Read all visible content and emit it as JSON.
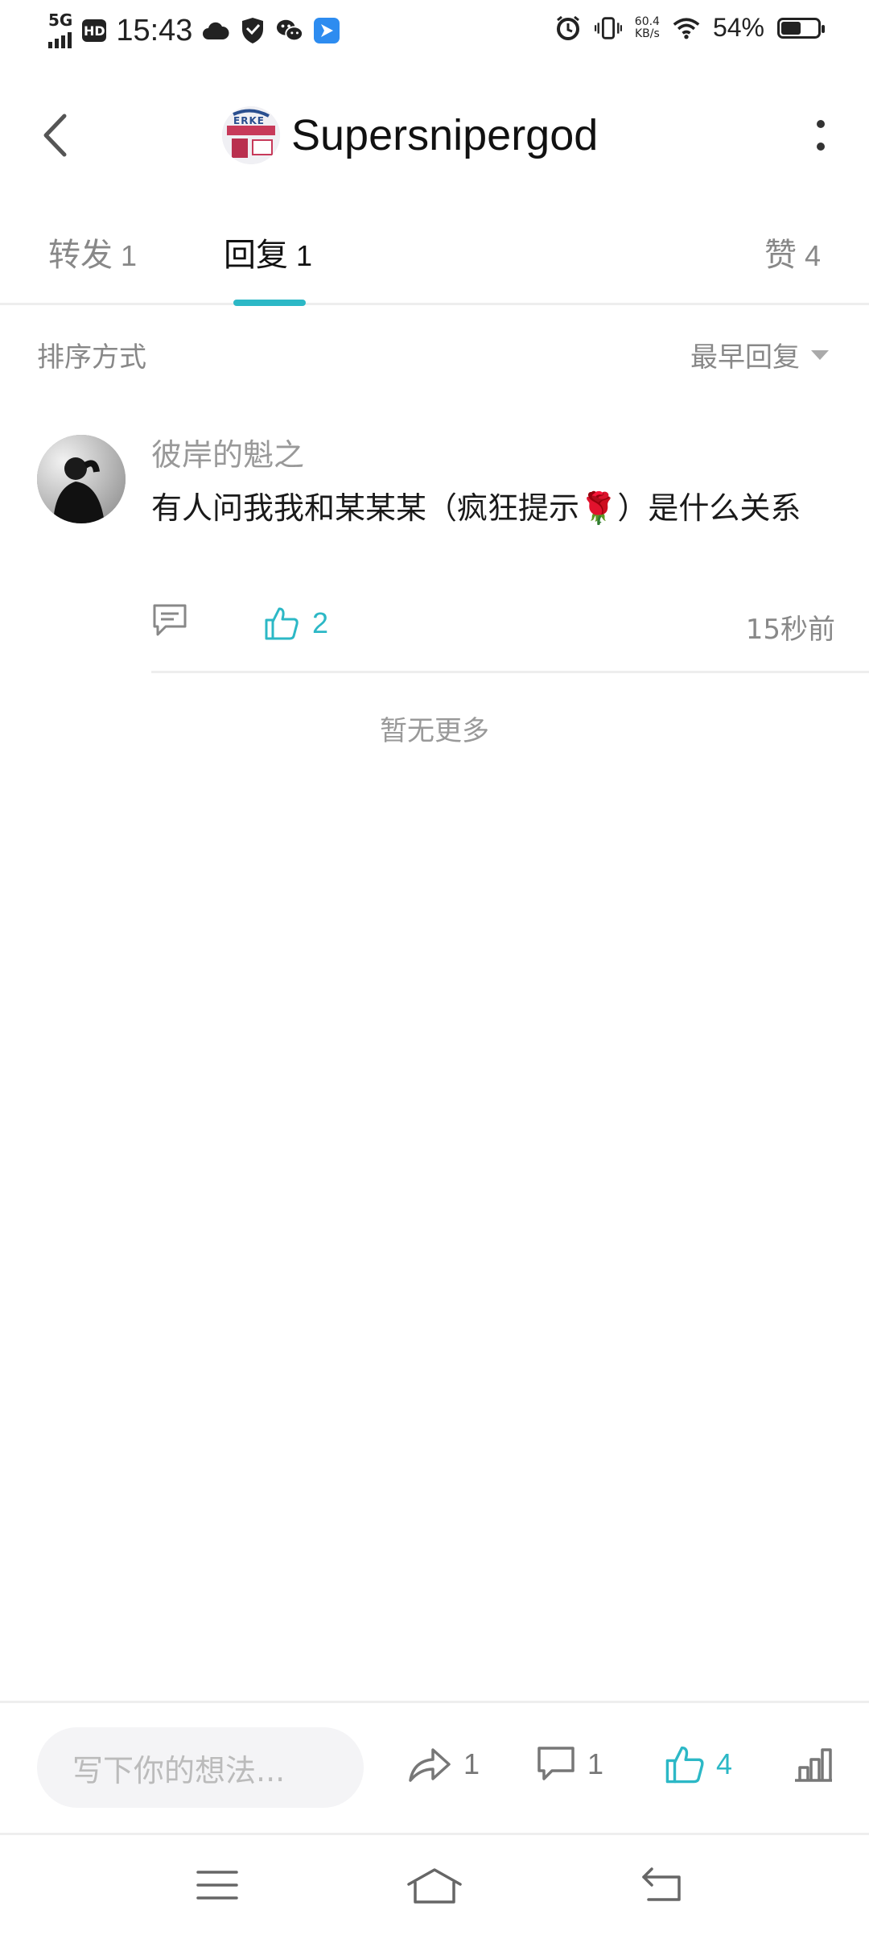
{
  "status_bar": {
    "network": "5G",
    "hd": "HD",
    "time": "15:43",
    "speed_value": "60.4",
    "speed_unit": "KB/s",
    "battery_percent": "54%",
    "battery_level": 0.54
  },
  "header": {
    "title": "Supersnipergod",
    "avatar_text": "ERKE"
  },
  "tabs": [
    {
      "label": "转发",
      "count": "1"
    },
    {
      "label": "回复",
      "count": "1"
    },
    {
      "label": "赞",
      "count": "4"
    }
  ],
  "sort": {
    "label": "排序方式",
    "value": "最早回复"
  },
  "comment": {
    "author": "彼岸的魁之",
    "text_before_emoji": "有人问我我和某某某（疯狂提示",
    "emoji": "🌹",
    "text_after_emoji": "）是什么关系",
    "likes": "2",
    "time": "15秒前"
  },
  "no_more_text": "暂无更多",
  "bottom_bar": {
    "input_placeholder": "写下你的想法...",
    "share_count": "1",
    "comment_count": "1",
    "like_count": "4"
  },
  "colors": {
    "accent": "#2cb8c6",
    "muted": "#888888"
  },
  "icons": [
    "back-arrow-icon",
    "more-vertical-icon",
    "reply-icon",
    "thumbs-up-icon",
    "share-icon",
    "comment-icon",
    "stats-icon",
    "menu-icon",
    "home-icon",
    "back-icon"
  ]
}
